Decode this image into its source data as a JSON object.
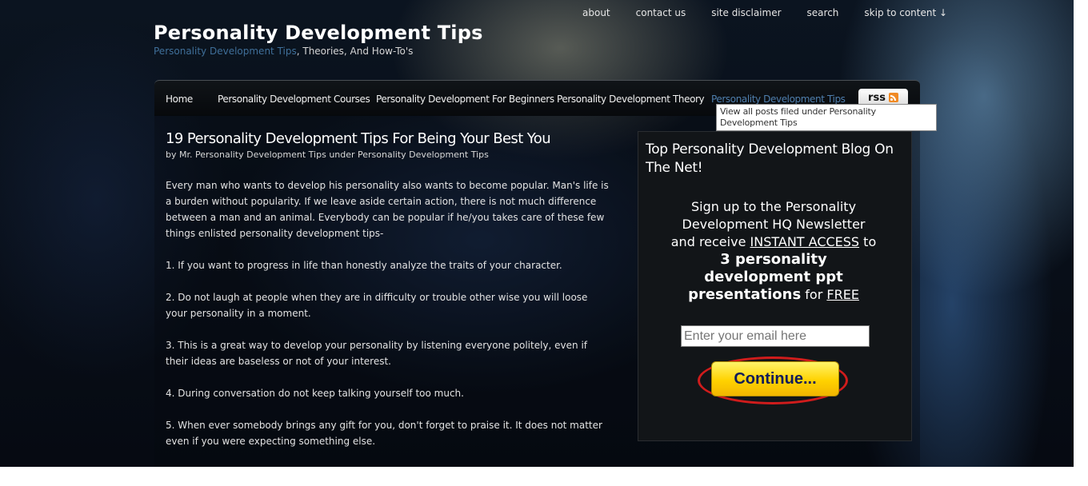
{
  "topnav": {
    "items": [
      "about",
      "contact us",
      "site disclaimer",
      "search",
      "skip to content ↓"
    ]
  },
  "site": {
    "title": "Personality Development Tips",
    "tagline_highlight": "Personality Development Tips",
    "tagline_rest": ", Theories, And How-To's"
  },
  "nav": {
    "items": [
      "Home",
      "Personality Development Courses",
      "Personality Development For Beginners",
      "Personality Development Theory",
      "Personality Development Tips"
    ],
    "active_index": 4,
    "rss_label": "rss",
    "tooltip": "View all posts filed under Personality Development Tips"
  },
  "post": {
    "title": "19 Personality Development Tips For Being Your Best You",
    "byline": "by Mr. Personality Development Tips under Personality Development Tips",
    "paragraphs": [
      "Every man who wants to develop his personality also wants to become popular. Man's life is a burden without popularity. If we leave aside certain action, there is not much difference between a man and an animal. Everybody can be popular if he/you takes care of these few things enlisted personality development tips-",
      "1. If you want to progress in life than honestly analyze the traits of your character.",
      "2. Do not laugh at people when they are in difficulty or trouble other wise you will loose your personality in a moment.",
      "3. This is a great way to develop your personality by listening everyone politely, even if their ideas are baseless or not of your interest.",
      "4. During conversation do not keep talking yourself too much.",
      "5. When ever somebody brings any gift for you, don't forget to praise it. It does not matter even if you were expecting something else."
    ]
  },
  "sidebar": {
    "title": "Top Personality Development Blog On The Net!",
    "signup_1": "Sign up to the Personality Development HQ Newsletter and receive",
    "signup_instant": "INSTANT ACCESS",
    "signup_to": "to",
    "signup_bold": "3 personality development ppt presentations",
    "signup_for": "for",
    "signup_free": "FREE",
    "email_placeholder": "Enter your email here",
    "button_label": "Continue..."
  }
}
